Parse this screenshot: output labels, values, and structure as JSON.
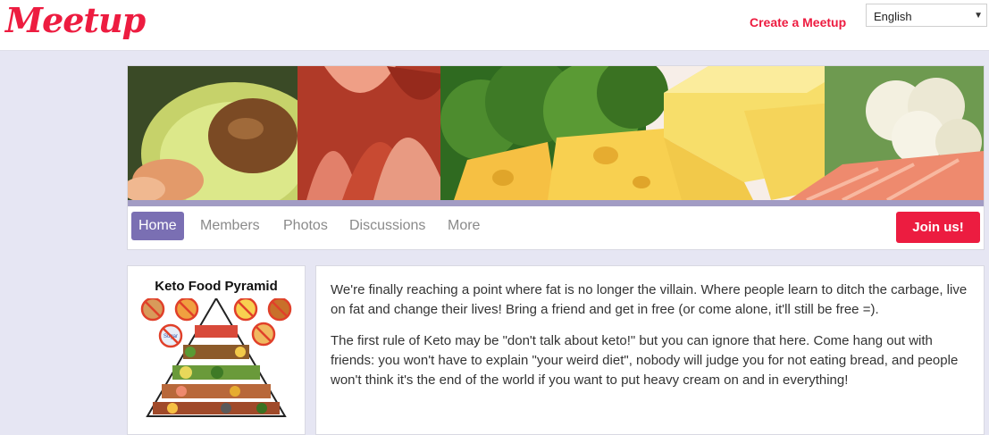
{
  "header": {
    "logo_text": "Meetup",
    "create_link": "Create a Meetup",
    "language": {
      "selected": "English"
    }
  },
  "colors": {
    "brand": "#ed1c40",
    "nav_active": "#7a6fb3",
    "page_bg": "#e6e6f3"
  },
  "group": {
    "banner_image": "keto-foods-banner",
    "tabs": [
      {
        "label": "Home",
        "active": true
      },
      {
        "label": "Members",
        "active": false
      },
      {
        "label": "Photos",
        "active": false
      },
      {
        "label": "Discussions",
        "active": false
      },
      {
        "label": "More",
        "active": false
      }
    ],
    "join_label": "Join us!"
  },
  "sidebar": {
    "pyramid_title": "Keto Food Pyramid",
    "sugar_label": "Sugar"
  },
  "description": {
    "paragraphs": [
      "We're finally reaching a point where fat is no longer the villain. Where people learn to ditch the carbage, live on fat and change their lives! Bring a friend and get in free (or come alone, it'll still be free =).",
      "The first rule of Keto may be \"don't talk about keto!\" but you can ignore that here. Come hang out with friends: you won't have to explain \"your weird diet\", nobody will judge you for not eating bread, and people won't think it's the end of the world if you want to put heavy cream on and in everything!"
    ]
  }
}
